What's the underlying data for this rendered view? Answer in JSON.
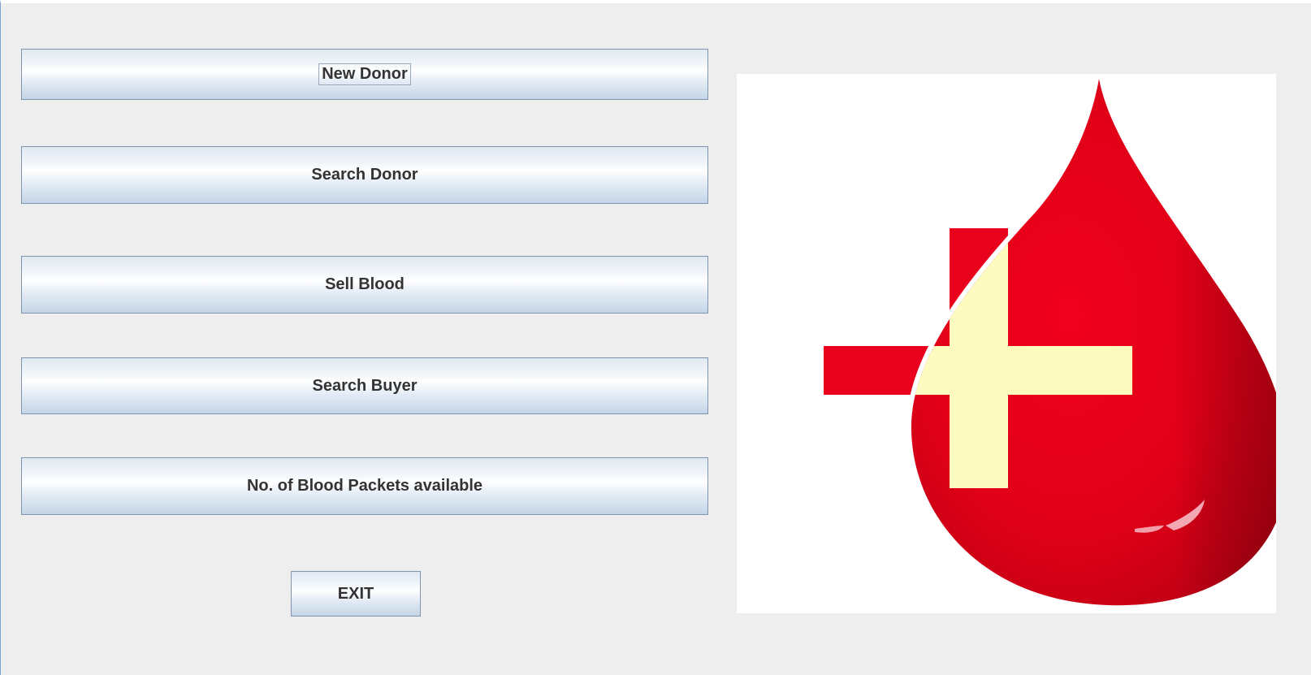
{
  "menu": {
    "new_donor_label": "New Donor",
    "search_donor_label": "Search Donor",
    "sell_blood_label": "Sell Blood",
    "search_buyer_label": "Search Buyer",
    "blood_packets_label": "No. of Blood Packets available",
    "exit_label": "EXIT"
  },
  "logo": {
    "icon": "blood-drop-with-cross",
    "drop_color": "#e8001c",
    "cross_red_color": "#e8001c",
    "cross_light_color": "#fdfbbf"
  }
}
